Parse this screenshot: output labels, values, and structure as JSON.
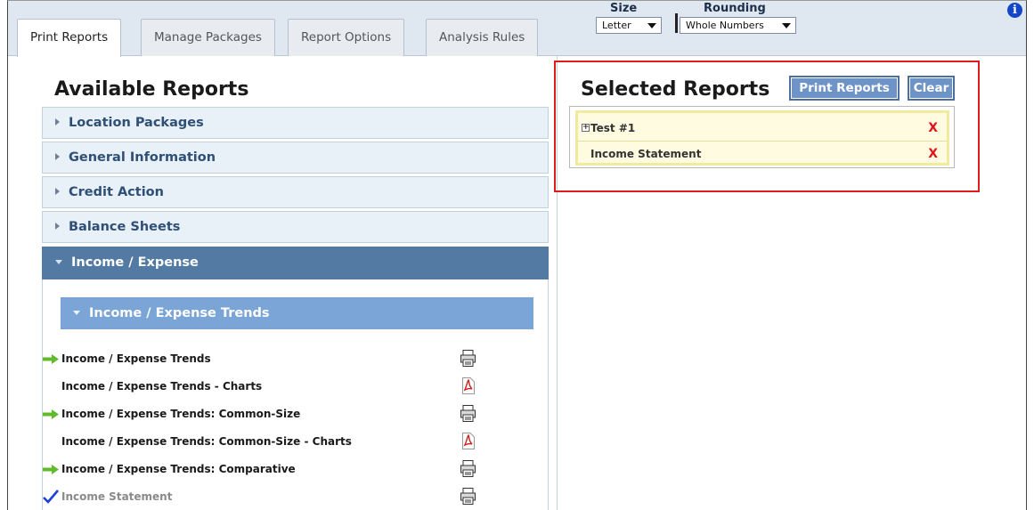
{
  "tabs": [
    {
      "label": "Print Reports",
      "active": true
    },
    {
      "label": "Manage Packages",
      "active": false
    },
    {
      "label": "Report Options",
      "active": false
    },
    {
      "label": "Analysis Rules",
      "active": false
    }
  ],
  "options": {
    "size_label": "Size",
    "size_value": "Letter",
    "rounding_label": "Rounding",
    "rounding_value": "Whole Numbers",
    "info_glyph": "i"
  },
  "available": {
    "title": "Available Reports",
    "sections": [
      {
        "label": "Location Packages",
        "expanded": false
      },
      {
        "label": "General Information",
        "expanded": false
      },
      {
        "label": "Credit Action",
        "expanded": false
      },
      {
        "label": "Balance Sheets",
        "expanded": false
      },
      {
        "label": "Income / Expense",
        "expanded": true
      }
    ],
    "subsection": {
      "label": "Income / Expense Trends",
      "expanded": true
    },
    "reports": [
      {
        "label": "Income / Expense Trends",
        "marker": "green-arrow-icon",
        "format": "print-icon"
      },
      {
        "label": "Income / Expense Trends - Charts",
        "marker": "",
        "format": "pdf-icon"
      },
      {
        "label": "Income / Expense Trends: Common-Size",
        "marker": "green-arrow-icon",
        "format": "print-icon"
      },
      {
        "label": "Income / Expense Trends: Common-Size - Charts",
        "marker": "",
        "format": "pdf-icon"
      },
      {
        "label": "Income / Expense Trends: Comparative",
        "marker": "green-arrow-icon",
        "format": "print-icon"
      },
      {
        "label": "Income Statement",
        "marker": "checkmark-icon",
        "format": "print-icon"
      }
    ]
  },
  "selected": {
    "title": "Selected Reports",
    "print_label": "Print Reports",
    "clear_label": "Clear",
    "items": [
      {
        "label": "Test #1",
        "expandable": true,
        "remove": "X"
      },
      {
        "label": "Income Statement",
        "expandable": false,
        "remove": "X"
      }
    ]
  },
  "colors": {
    "accent": "#537aa2",
    "highlight_border": "#e01b1b",
    "remove_red": "#e0141a",
    "arrow_green": "#5fbb2a",
    "check_blue": "#1b3fd6"
  }
}
